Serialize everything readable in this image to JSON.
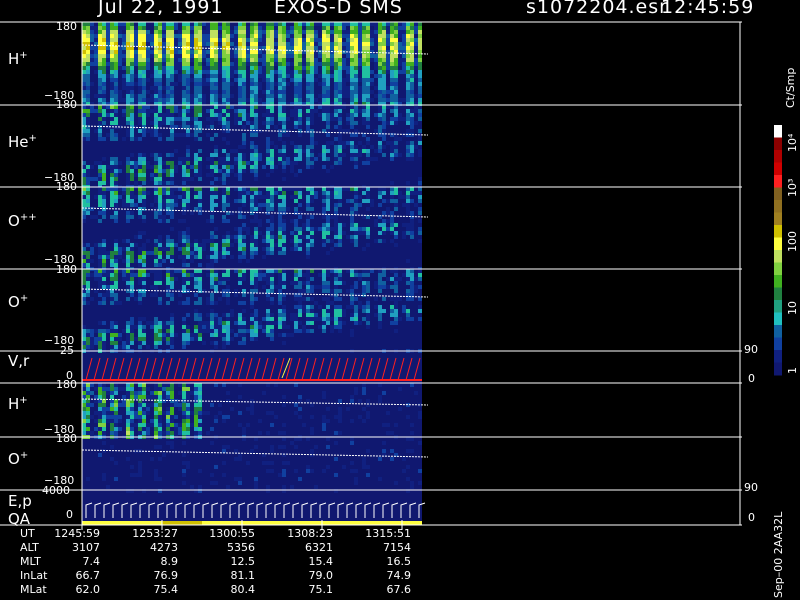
{
  "header": {
    "date": "Jul 22, 1991",
    "instrument": "EXOS-D SMS",
    "file": "s1072204.esr",
    "time": "12:45:59"
  },
  "panels": [
    {
      "species": "H",
      "charge": "+",
      "ytop": "180",
      "ybot": "−180"
    },
    {
      "species": "He",
      "charge": "+",
      "ytop": "180",
      "ybot": "−180"
    },
    {
      "species": "O",
      "charge": "++",
      "ytop": "180",
      "ybot": "−180"
    },
    {
      "species": "O",
      "charge": "+",
      "ytop": "180",
      "ybot": "−180"
    }
  ],
  "vr_panel": {
    "label": "V,r",
    "ytop": "25",
    "ybot": "0",
    "right_top": "90",
    "right_bot": "0"
  },
  "panels2": [
    {
      "species": "H",
      "charge": "+",
      "ytop": "180",
      "ybot": "−180"
    },
    {
      "species": "O",
      "charge": "+",
      "ytop": "180",
      "ybot": "−180"
    }
  ],
  "ep_panel": {
    "label1": "E,p",
    "label2": "QA",
    "ytop": "4000",
    "ybot": "0",
    "right_top": "90",
    "right_bot": "0"
  },
  "colorbar": {
    "unit": "Ct/Smp",
    "ticks": [
      "10⁴",
      "10³",
      "100",
      "10",
      "1"
    ],
    "colors": [
      "#ffffff",
      "#8b0000",
      "#b00000",
      "#d00000",
      "#ff2020",
      "#806020",
      "#907020",
      "#a08020",
      "#d0c000",
      "#ffff40",
      "#c0e060",
      "#80d040",
      "#40b020",
      "#208040",
      "#20a080",
      "#20c0c0",
      "#1060a0",
      "#1040a0",
      "#102080",
      "#101870"
    ]
  },
  "ut_rows": [
    {
      "label": "UT",
      "values": [
        "1245:59",
        "1253:27",
        "1300:55",
        "1308:23",
        "1315:51"
      ]
    },
    {
      "label": "ALT",
      "values": [
        "3107",
        "4273",
        "5356",
        "6321",
        "7154"
      ]
    },
    {
      "label": "MLT",
      "values": [
        "7.4",
        "8.9",
        "12.5",
        "15.4",
        "16.5"
      ]
    },
    {
      "label": "InLat",
      "values": [
        "66.7",
        "76.9",
        "81.1",
        "79.0",
        "74.9"
      ]
    },
    {
      "label": "MLat",
      "values": [
        "62.0",
        "75.4",
        "80.4",
        "75.1",
        "67.6"
      ]
    }
  ],
  "footer_id": "Sep–00 2AA32L",
  "chart_data": {
    "type": "heatmap",
    "title": "Jul 22, 1991 EXOS-D SMS",
    "x_ticks": [
      "1245:59",
      "1253:27",
      "1300:55",
      "1308:23",
      "1315:51"
    ],
    "panels": [
      "H+",
      "He+",
      "O++",
      "O+",
      "V,r",
      "H+",
      "O+",
      "E,p QA"
    ],
    "pitch_angle_range": [
      -180,
      180
    ],
    "vr_range": [
      0,
      25
    ],
    "energy_range": [
      0,
      4000
    ],
    "colorbar_range_ct_per_smp": [
      1,
      10000
    ],
    "colorbar_scale": "log"
  }
}
